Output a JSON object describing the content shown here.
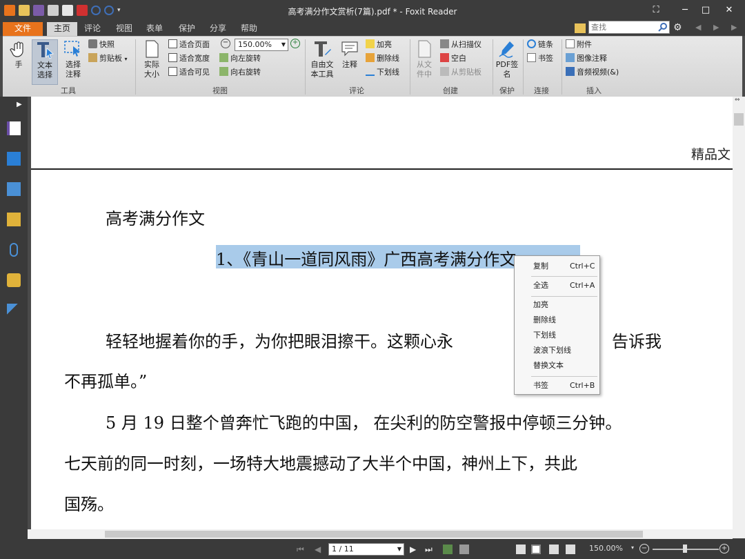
{
  "window": {
    "title": "高考满分作文赏析(7篇).pdf * - Foxit Reader"
  },
  "menu_tabs": [
    "文件",
    "主页",
    "评论",
    "视图",
    "表单",
    "保护",
    "分享",
    "帮助"
  ],
  "search": {
    "placeholder": "查找"
  },
  "ribbon": {
    "tools": {
      "hand": "手",
      "select_text": "文本选择",
      "select_annotation": "选择注释",
      "snapshot": "快照",
      "clipboard": "剪贴板",
      "group_label": "工具"
    },
    "view": {
      "actual_size": "实际大小",
      "fit_page": "适合页面",
      "fit_width": "适合宽度",
      "fit_visible": "适合可见",
      "zoom_value": "150.00%",
      "rotate_left": "向左旋转",
      "rotate_right": "向右旋转",
      "group_label": "视图"
    },
    "comment": {
      "free_text": "自由文本工具",
      "note": "注释",
      "highlight": "加亮",
      "strikeout": "删除线",
      "underline": "下划线",
      "group_label": "评论"
    },
    "create": {
      "from_file": "从文件中",
      "from_scanner": "从扫描仪",
      "blank": "空白",
      "from_clipboard": "从剪贴板",
      "group_label": "创建"
    },
    "protect": {
      "pdf_sign": "PDF签名",
      "group_label": "保护"
    },
    "link": {
      "link": "链条",
      "bookmark": "书签",
      "group_label": "连接"
    },
    "insert": {
      "attachment": "附件",
      "image_annotation": "图像注释",
      "audio_video": "音频视频(&)",
      "group_label": "插入"
    }
  },
  "document": {
    "header_right": "精品文",
    "heading": "高考满分作文",
    "title_line": "1、《青山一道同风雨》广西高考满分作文",
    "para1_line1_a": "轻轻地握着你的手，为你把眼泪擦干。这颗心永",
    "para1_line1_b": "告诉我",
    "para1_line2": "不再孤单。”",
    "para2_line1": "5 月 19 日整个曾奔忙飞跑的中国，  在尖利的防空警报中停顿三分钟。",
    "para2_line2": "七天前的同一时刻，一场特大地震撼动了大半个中国，神州上下，共此",
    "para2_line3": "国殇。"
  },
  "context_menu": {
    "items": [
      {
        "label": "复制",
        "shortcut": "Ctrl+C"
      },
      {
        "label": "全选",
        "shortcut": "Ctrl+A"
      },
      {
        "label": "加亮",
        "shortcut": ""
      },
      {
        "label": "删除线",
        "shortcut": ""
      },
      {
        "label": "下划线",
        "shortcut": ""
      },
      {
        "label": "波浪下划线",
        "shortcut": ""
      },
      {
        "label": "替换文本",
        "shortcut": ""
      },
      {
        "label": "书签",
        "shortcut": "Ctrl+B"
      }
    ]
  },
  "status": {
    "page_indicator": "1 / 11",
    "zoom": "150.00%"
  },
  "colors": {
    "accent_orange": "#e8731c",
    "selection_highlight": "#a9cbea",
    "chrome_dark": "#3c3c3c"
  },
  "icons": [
    "app-logo-icon",
    "open-icon",
    "save-icon",
    "print-icon",
    "email-icon",
    "undo-icon",
    "redo-icon",
    "hand-icon",
    "text-select-icon",
    "annotation-select-icon",
    "camera-icon",
    "clipboard-icon",
    "search-icon",
    "gear-icon"
  ]
}
